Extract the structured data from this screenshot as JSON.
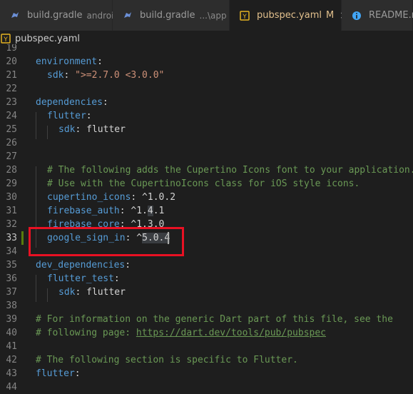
{
  "tabs": [
    {
      "label": "build.gradle",
      "desc": "android",
      "icon": "elephant-icon",
      "active": false
    },
    {
      "label": "build.gradle",
      "desc": "...\\app",
      "icon": "elephant-icon",
      "active": false
    },
    {
      "label": "pubspec.yaml",
      "modified": "M",
      "close": "×",
      "icon": "yaml-icon",
      "active": true
    },
    {
      "label": "README.md",
      "icon": "info-icon",
      "active": false
    }
  ],
  "breadcrumb": {
    "file": "pubspec.yaml",
    "icon": "yaml-icon"
  },
  "lines": [
    {
      "n": "19"
    },
    {
      "n": "20",
      "a": "environment",
      "b": ":"
    },
    {
      "n": "21",
      "a": "sdk",
      "b": ": ",
      "c": "\">=2.7.0 <3.0.0\""
    },
    {
      "n": "22"
    },
    {
      "n": "23",
      "a": "dependencies",
      "b": ":"
    },
    {
      "n": "24",
      "a": "flutter",
      "b": ":"
    },
    {
      "n": "25",
      "a": "sdk",
      "b": ": flutter"
    },
    {
      "n": "26"
    },
    {
      "n": "27"
    },
    {
      "n": "28",
      "cm": "# The following adds the Cupertino Icons font to your application."
    },
    {
      "n": "29",
      "cm": "# Use with the CupertinoIcons class for iOS style icons."
    },
    {
      "n": "30",
      "a": "cupertino_icons",
      "b": ": ^1.0.2"
    },
    {
      "n": "31",
      "a": "firebase_auth",
      "b": ": ^1.",
      "h": "4",
      "c": ".1"
    },
    {
      "n": "32",
      "a": "firebase_core",
      "b": ": ^1.3.0"
    },
    {
      "n": "33",
      "a": "google_sign_in",
      "b": ": ^",
      "h": "5.0.4"
    },
    {
      "n": "34"
    },
    {
      "n": "35",
      "a": "dev_dependencies",
      "b": ":"
    },
    {
      "n": "36",
      "a": "flutter_test",
      "b": ":"
    },
    {
      "n": "37",
      "a": "sdk",
      "b": ": flutter"
    },
    {
      "n": "38"
    },
    {
      "n": "39",
      "cm": "# For information on the generic Dart part of this file, see the"
    },
    {
      "n": "40",
      "cm": "# following page: ",
      "url": "https://dart.dev/tools/pub/pubspec"
    },
    {
      "n": "41"
    },
    {
      "n": "42",
      "cm": "# The following section is specific to Flutter."
    },
    {
      "n": "43",
      "a": "flutter",
      "b": ":"
    },
    {
      "n": "44"
    }
  ]
}
